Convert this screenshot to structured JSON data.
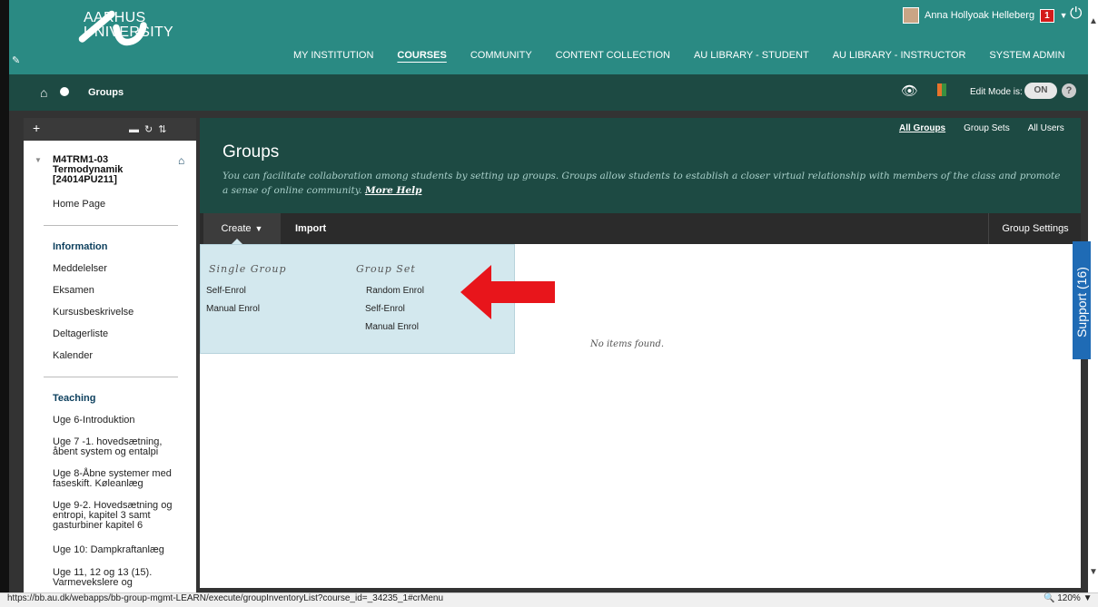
{
  "header": {
    "logo_line1": "AARHUS",
    "logo_line2": "UNIVERSITY",
    "user_name": "Anna Hollyoak Helleberg",
    "notification_count": "1",
    "nav": [
      {
        "label": "MY INSTITUTION"
      },
      {
        "label": "COURSES"
      },
      {
        "label": "COMMUNITY"
      },
      {
        "label": "CONTENT COLLECTION"
      },
      {
        "label": "AU LIBRARY - STUDENT"
      },
      {
        "label": "AU LIBRARY - INSTRUCTOR"
      },
      {
        "label": "SYSTEM ADMIN"
      }
    ],
    "active_nav": "COURSES"
  },
  "breadcrumb": {
    "title": "Groups",
    "edit_mode_label": "Edit Mode is:",
    "edit_mode_state": "ON",
    "help": "?"
  },
  "sidebar": {
    "course_title": "M4TRM1-03 Termodynamik [24014PU211]",
    "home_page": "Home Page",
    "section_information": "Information",
    "information_items": [
      "Meddelelser",
      "Eksamen",
      "Kursusbeskrivelse",
      "Deltagerliste",
      "Kalender"
    ],
    "section_teaching": "Teaching",
    "teaching_items": [
      "Uge 6-Introduktion",
      "Uge 7 -1. hovedsætning, åbent system og entalpi",
      "Uge 8-Åbne systemer med faseskift. Køleanlæg",
      "Uge 9-2. Hovedsætning og entropi, kapitel 3 samt gasturbiner kapitel 6",
      "Uge 10: Dampkraftanlæg",
      "Uge 11, 12 og 13 (15). Varmevekslere og"
    ]
  },
  "content": {
    "tabs": [
      "All Groups",
      "Group Sets",
      "All Users"
    ],
    "title": "Groups",
    "description": "You can facilitate collaboration among students by setting up groups. Groups allow students to establish a closer virtual relationship with members of the class and promote a sense of online community.",
    "more_help": "More Help",
    "create_label": "Create",
    "import_label": "Import",
    "group_settings_label": "Group Settings",
    "empty_message": "No items found."
  },
  "dropdown": {
    "single_group_heading": "Single Group",
    "single_group_items": [
      "Self-Enrol",
      "Manual Enrol"
    ],
    "group_set_heading": "Group Set",
    "group_set_items": [
      "Random Enrol",
      "Self-Enrol",
      "Manual Enrol"
    ]
  },
  "support": {
    "label": "Support (16)"
  },
  "status_bar": {
    "url": "https://bb.au.dk/webapps/bb-group-mgmt-LEARN/execute/groupInventoryList?course_id=_34235_1#crMenu",
    "zoom": "120%"
  },
  "colors": {
    "header_teal": "#2a8a83",
    "dark_teal": "#1d4a43",
    "dropdown_blue": "#d3e8ee",
    "arrow_red": "#e8151b",
    "support_blue": "#1f6bb5"
  }
}
